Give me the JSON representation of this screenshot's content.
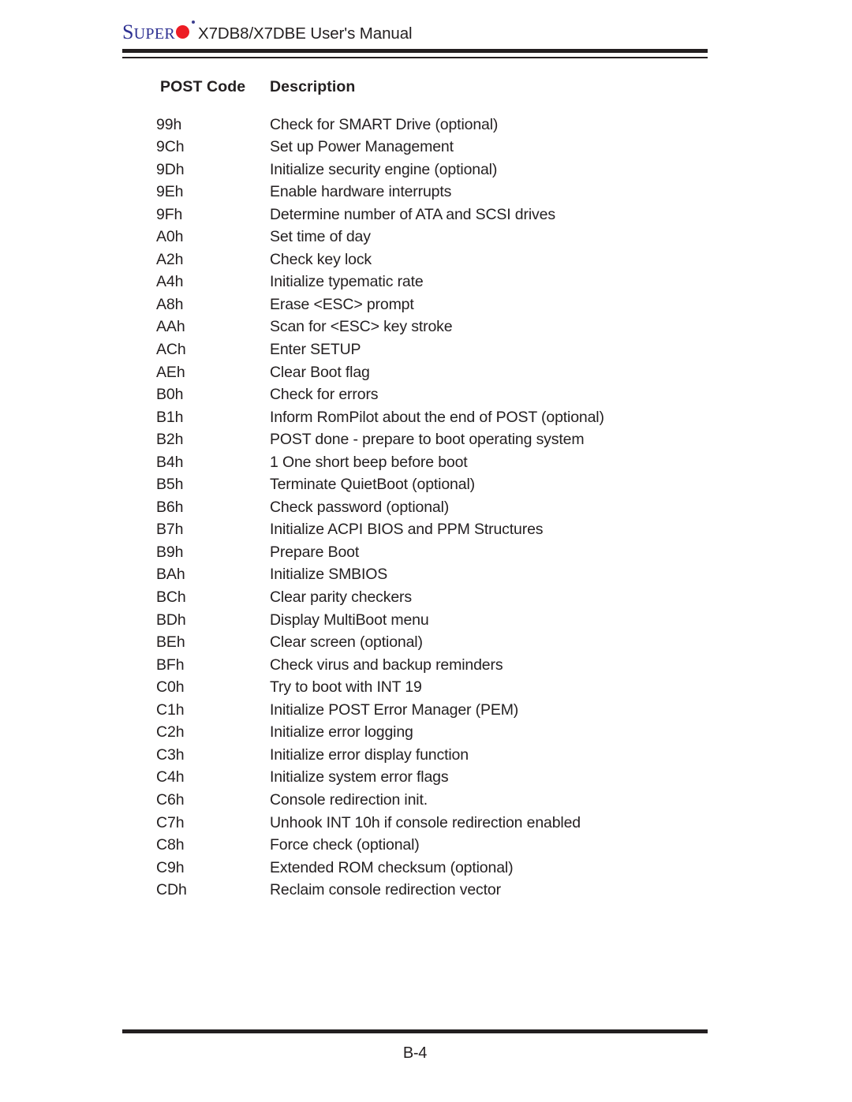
{
  "header": {
    "logo_s": "S",
    "logo_uper": "UPER",
    "logo_icon": "red-circle-o",
    "manual_title": "X7DB8/X7DBE User's Manual"
  },
  "table": {
    "columns": [
      "POST Code",
      "Description"
    ],
    "rows": [
      [
        "99h",
        "Check for SMART Drive (optional)"
      ],
      [
        "9Ch",
        "Set up Power Management"
      ],
      [
        "9Dh",
        "Initialize security engine (optional)"
      ],
      [
        "9Eh",
        "Enable hardware interrupts"
      ],
      [
        "9Fh",
        "Determine number of ATA and SCSI drives"
      ],
      [
        "A0h",
        "Set time of day"
      ],
      [
        "A2h",
        "Check key lock"
      ],
      [
        "A4h",
        "Initialize typematic rate"
      ],
      [
        "A8h",
        "Erase <ESC> prompt"
      ],
      [
        "AAh",
        "Scan for <ESC> key stroke"
      ],
      [
        "ACh",
        "Enter SETUP"
      ],
      [
        "AEh",
        "Clear Boot flag"
      ],
      [
        "B0h",
        "Check for errors"
      ],
      [
        "B1h",
        "Inform RomPilot about the end of POST (optional)"
      ],
      [
        "B2h",
        "POST done - prepare to boot operating system"
      ],
      [
        "B4h",
        "1 One short beep before boot"
      ],
      [
        "B5h",
        "Terminate QuietBoot (optional)"
      ],
      [
        "B6h",
        "Check password (optional)"
      ],
      [
        "B7h",
        "Initialize ACPI BIOS and PPM Structures"
      ],
      [
        "B9h",
        "Prepare Boot"
      ],
      [
        "BAh",
        "Initialize SMBIOS"
      ],
      [
        "BCh",
        "Clear parity checkers"
      ],
      [
        "BDh",
        "Display MultiBoot menu"
      ],
      [
        "BEh",
        "Clear screen (optional)"
      ],
      [
        "BFh",
        "Check virus and backup reminders"
      ],
      [
        "C0h",
        "Try to boot with INT 19"
      ],
      [
        "C1h",
        "Initialize POST Error Manager (PEM)"
      ],
      [
        "C2h",
        "Initialize error logging"
      ],
      [
        "C3h",
        "Initialize error display function"
      ],
      [
        "C4h",
        "Initialize system error flags"
      ],
      [
        "C6h",
        "Console redirection init."
      ],
      [
        "C7h",
        "Unhook INT 10h if console redirection enabled"
      ],
      [
        "C8h",
        "Force check (optional)"
      ],
      [
        "C9h",
        "Extended ROM checksum (optional)"
      ],
      [
        "CDh",
        "Reclaim console redirection vector"
      ]
    ]
  },
  "footer": {
    "page_number": "B-4"
  },
  "colors": {
    "text": "#231f20",
    "logo_blue": "#2e3192",
    "logo_red": "#ed1c24"
  }
}
